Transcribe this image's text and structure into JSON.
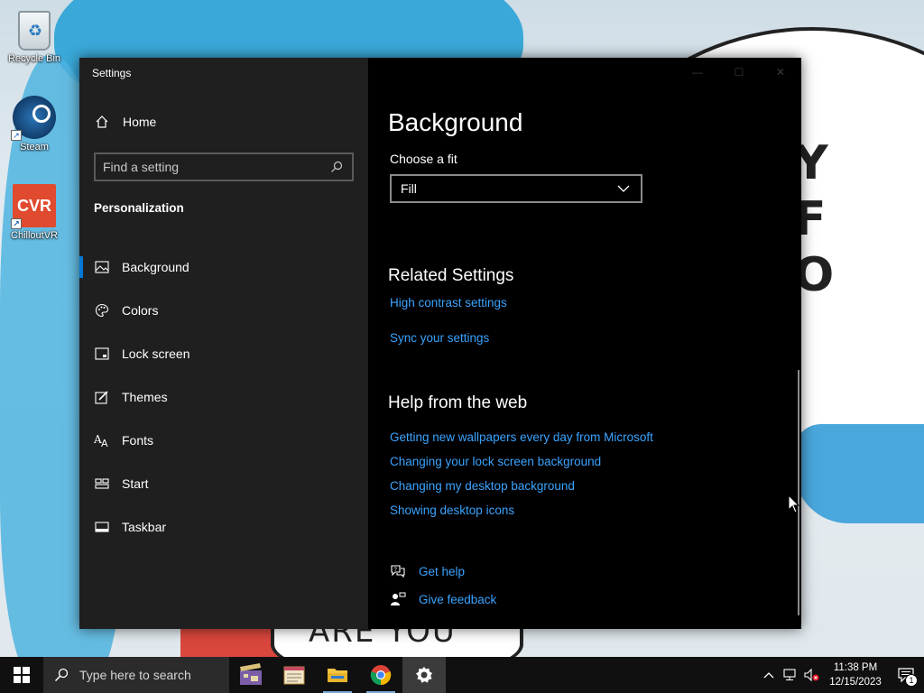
{
  "desktop": {
    "icons": [
      {
        "label": "Recycle Bin",
        "icon": "recycle-bin-icon"
      },
      {
        "label": "Steam",
        "icon": "steam-icon"
      },
      {
        "label": "ChilloutVR",
        "icon": "chilloutvr-icon",
        "glyph": "CVR"
      }
    ],
    "wallpaper": {
      "bubble_text": "Y\nF\nO",
      "bottom_text": "ARE YOU"
    }
  },
  "window": {
    "title": "Settings",
    "controls": {
      "minimize": "—",
      "maximize": "☐",
      "close": "✕"
    },
    "sidebar": {
      "home_label": "Home",
      "search_placeholder": "Find a setting",
      "section_label": "Personalization",
      "items": [
        {
          "label": "Background",
          "icon": "image-icon",
          "active": true
        },
        {
          "label": "Colors",
          "icon": "palette-icon",
          "active": false
        },
        {
          "label": "Lock screen",
          "icon": "lock-screen-icon",
          "active": false
        },
        {
          "label": "Themes",
          "icon": "themes-icon",
          "active": false
        },
        {
          "label": "Fonts",
          "icon": "fonts-icon",
          "active": false
        },
        {
          "label": "Start",
          "icon": "start-icon",
          "active": false
        },
        {
          "label": "Taskbar",
          "icon": "taskbar-icon",
          "active": false
        }
      ]
    },
    "main": {
      "title": "Background",
      "fit_label": "Choose a fit",
      "fit_value": "Fill",
      "related_heading": "Related Settings",
      "related_links": [
        "High contrast settings",
        "Sync your settings"
      ],
      "help_heading": "Help from the web",
      "help_links": [
        "Getting new wallpapers every day from Microsoft",
        "Changing your lock screen background",
        "Changing my desktop background",
        "Showing desktop icons"
      ],
      "get_help": "Get help",
      "give_feedback": "Give feedback"
    }
  },
  "taskbar": {
    "search_placeholder": "Type here to search",
    "apps": [
      "video-editor-icon",
      "notepad-icon",
      "file-explorer-icon",
      "chrome-icon",
      "settings-icon"
    ],
    "time": "11:38 PM",
    "date": "12/15/2023",
    "notification_count": "1",
    "colors": {
      "accent": "#0078d7",
      "link": "#3aa3ff"
    }
  }
}
